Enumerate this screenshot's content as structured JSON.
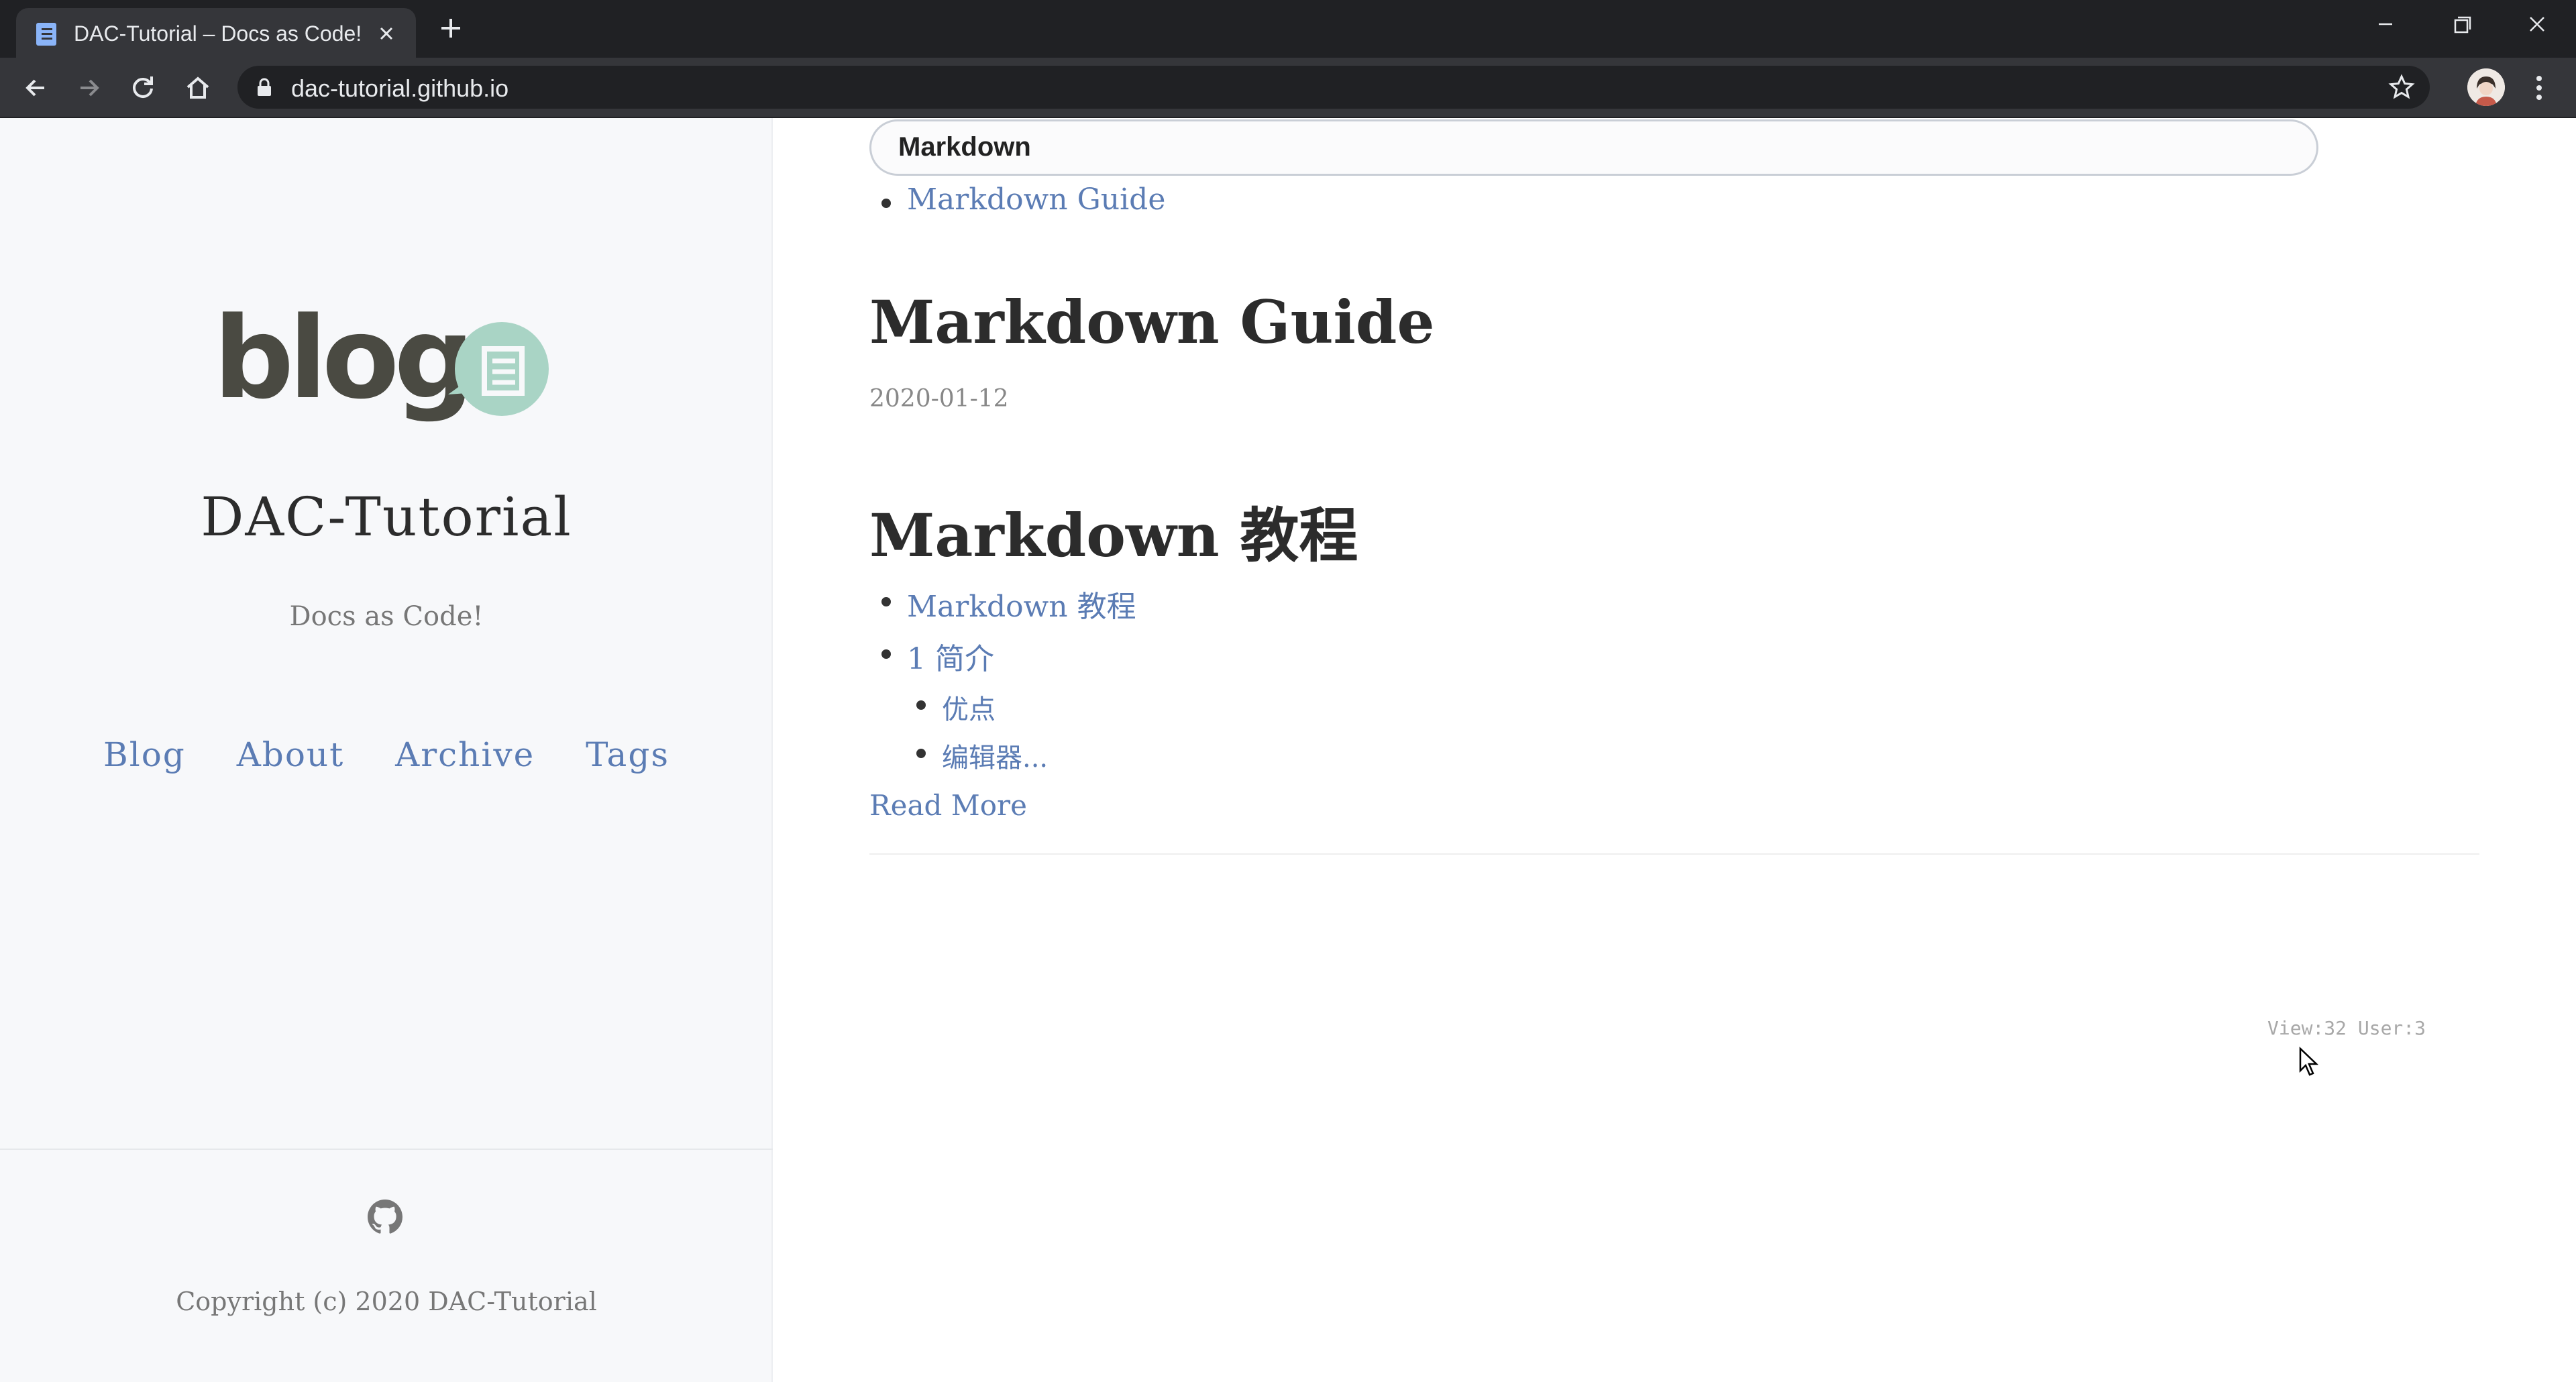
{
  "browser": {
    "tab_title": "DAC-Tutorial – Docs as Code!",
    "url": "dac-tutorial.github.io"
  },
  "sidebar": {
    "logo_text": "blog.",
    "site_title": "DAC-Tutorial",
    "site_description": "Docs as Code!",
    "nav": [
      "Blog",
      "About",
      "Archive",
      "Tags"
    ],
    "copyright": "Copyright (c) 2020 DAC-Tutorial"
  },
  "main": {
    "search_value": "Markdown",
    "results": [
      {
        "label": "Markdown Guide"
      }
    ],
    "posts": [
      {
        "title": "Markdown Guide",
        "date": "2020-01-12"
      },
      {
        "title": "Markdown 教程",
        "toc": [
          {
            "label": "Markdown 教程"
          },
          {
            "label": "1 简介"
          },
          {
            "label": "优点",
            "level": 2
          },
          {
            "label": "编辑器...",
            "level": 2
          }
        ],
        "read_more": "Read More"
      }
    ],
    "counter": "View:32 User:3"
  },
  "colors": {
    "link": "#5b7cb4",
    "sidebar_bg": "#f7f8fa",
    "logo_dark": "#4a4a42",
    "logo_accent": "#a9d4c5"
  }
}
